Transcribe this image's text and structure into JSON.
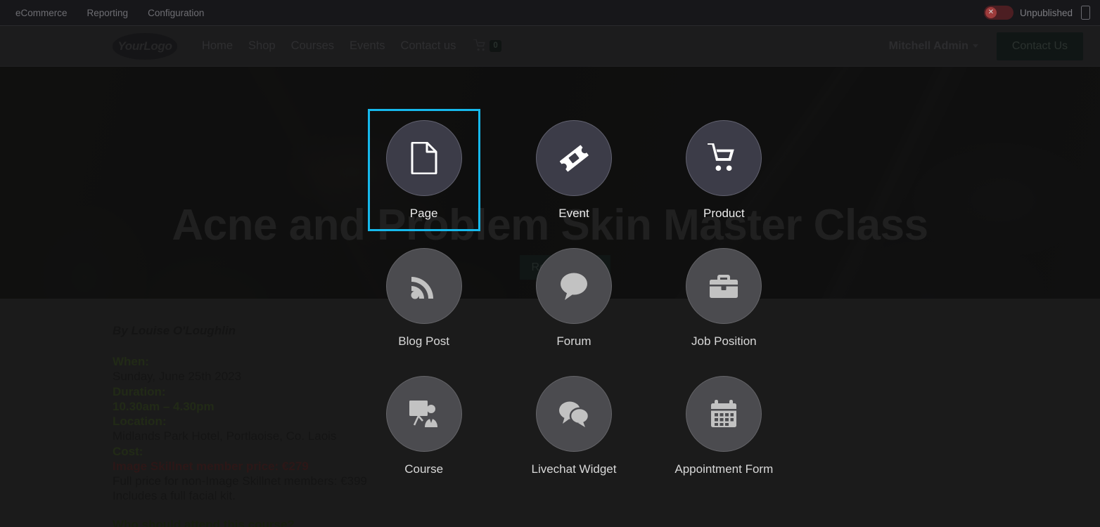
{
  "odoo_bar": {
    "menus": [
      {
        "label": "eCommerce",
        "name": "menu-ecommerce"
      },
      {
        "label": "Reporting",
        "name": "menu-reporting"
      },
      {
        "label": "Configuration",
        "name": "menu-configuration"
      }
    ],
    "publish_status": "Unpublished",
    "publish_toggle_glyph": "✕",
    "mobile_preview_icon": "mobile-preview-icon"
  },
  "site_header": {
    "logo_text": "YourLogo",
    "nav": [
      {
        "label": "Home"
      },
      {
        "label": "Shop"
      },
      {
        "label": "Courses"
      },
      {
        "label": "Events"
      },
      {
        "label": "Contact us"
      }
    ],
    "cart_glyph": "🛒",
    "cart_count": "0",
    "user_name": "Mitchell Admin",
    "cta_label": "Contact Us"
  },
  "hero": {
    "title": "Acne and Problem Skin Master Class",
    "register_label": "Register Now"
  },
  "article": {
    "byline": "By Louise O'Loughlin",
    "when_label": "When:",
    "when_value": "Sunday, June 25th 2023",
    "duration_label": "Duration:",
    "duration_value": "10.30am – 4.30pm",
    "location_label": "Location:",
    "location_value": "Midlands Park Hotel, Portlaoise, Co. Laois",
    "cost_label": "Cost:",
    "cost_member": "Image Skillnet member price: €279",
    "cost_full": "Full price for non-Image Skillnet members: €399",
    "cost_note": "Includes a full facial kit.",
    "question": "Who should attend this course?"
  },
  "new_content": {
    "selected": "Page",
    "highlight_color": "#16b9ec",
    "items": [
      {
        "label": "Page",
        "icon": "page-icon",
        "tone": "a"
      },
      {
        "label": "Event",
        "icon": "ticket-icon",
        "tone": "a"
      },
      {
        "label": "Product",
        "icon": "shopping-cart-icon",
        "tone": "a"
      },
      {
        "label": "Blog Post",
        "icon": "rss-icon",
        "tone": "b"
      },
      {
        "label": "Forum",
        "icon": "comment-icon",
        "tone": "b"
      },
      {
        "label": "Job Position",
        "icon": "briefcase-icon",
        "tone": "b"
      },
      {
        "label": "Course",
        "icon": "presentation-icon",
        "tone": "b"
      },
      {
        "label": "Livechat Widget",
        "icon": "comments-icon",
        "tone": "b"
      },
      {
        "label": "Appointment Form",
        "icon": "calendar-icon",
        "tone": "b"
      }
    ]
  }
}
